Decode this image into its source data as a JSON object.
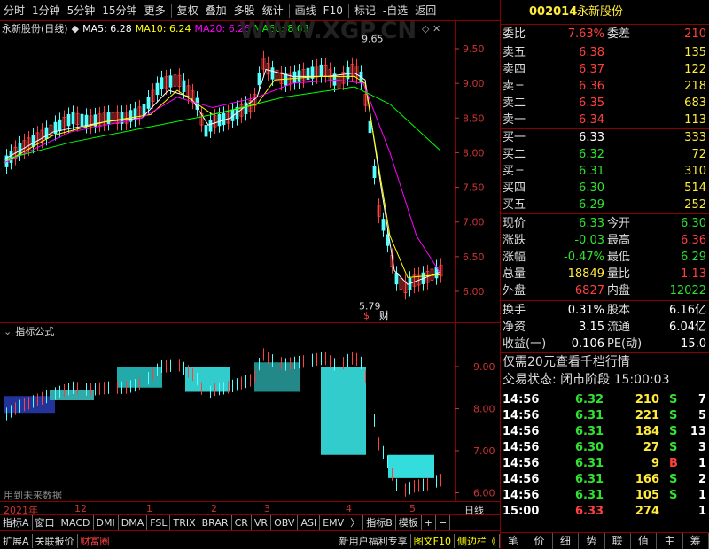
{
  "toolbar": {
    "items": [
      "分时",
      "1分钟",
      "5分钟",
      "15分钟",
      "更多",
      "复权",
      "叠加",
      "多股",
      "统计",
      "画线",
      "F10",
      "标记",
      "-自选",
      "返回"
    ]
  },
  "info": {
    "name": "永新股份(日线)",
    "ma5": "MA5: 6.28",
    "ma10": "MA10: 6.24",
    "ma20": "MA20: 6.26",
    "ma60": "MA60: 8.03"
  },
  "watermark": "WWW.XGP.CN",
  "annotations": {
    "high": "9.65",
    "low": "5.79",
    "flag1": "$",
    "flag2": "财"
  },
  "main_axis": {
    "ticks": [
      "9.50",
      "9.00",
      "8.50",
      "8.00",
      "7.50",
      "7.00",
      "6.50",
      "6.00"
    ]
  },
  "sub_axis": {
    "ticks": [
      "9.00",
      "8.00",
      "7.00",
      "6.00"
    ]
  },
  "sub": {
    "title": "指标公式",
    "hint": "用到未来数据"
  },
  "xaxis": {
    "labels": [
      "2021年",
      "12",
      "1",
      "2",
      "3",
      "4",
      "5"
    ],
    "mode": "日线"
  },
  "tabs": [
    "指标A",
    "窗口",
    "MACD",
    "DMI",
    "DMA",
    "FSL",
    "TRIX",
    "BRAR",
    "CR",
    "VR",
    "OBV",
    "ASI",
    "EMV",
    "〉",
    "指标B",
    "模板",
    "+",
    "−"
  ],
  "bottombar": [
    "扩展A",
    "关联报价",
    "财富圈",
    "新用户福利专享",
    "图文F10",
    "侧边栏《"
  ],
  "quote": {
    "code": "002014",
    "name": "永新股份",
    "weibi_label": "委比",
    "weibi": "7.63%",
    "weicha_label": "委差",
    "weicha": "210",
    "asks": [
      {
        "l": "卖五",
        "p": "6.38",
        "v": "135"
      },
      {
        "l": "卖四",
        "p": "6.37",
        "v": "122"
      },
      {
        "l": "卖三",
        "p": "6.36",
        "v": "218"
      },
      {
        "l": "卖二",
        "p": "6.35",
        "v": "683"
      },
      {
        "l": "卖一",
        "p": "6.34",
        "v": "113"
      }
    ],
    "bids": [
      {
        "l": "买一",
        "p": "6.33",
        "v": "333"
      },
      {
        "l": "买二",
        "p": "6.32",
        "v": "72"
      },
      {
        "l": "买三",
        "p": "6.31",
        "v": "310"
      },
      {
        "l": "买四",
        "p": "6.30",
        "v": "514"
      },
      {
        "l": "买五",
        "p": "6.29",
        "v": "252"
      }
    ],
    "stats": [
      {
        "l1": "现价",
        "v1": "6.33",
        "l2": "今开",
        "v2": "6.30"
      },
      {
        "l1": "涨跌",
        "v1": "-0.03",
        "l2": "最高",
        "v2": "6.36"
      },
      {
        "l1": "涨幅",
        "v1": "-0.47%",
        "l2": "最低",
        "v2": "6.29"
      },
      {
        "l1": "总量",
        "v1": "18849",
        "l2": "量比",
        "v2": "1.13"
      },
      {
        "l1": "外盘",
        "v1": "6827",
        "l2": "内盘",
        "v2": "12022"
      }
    ],
    "fund": [
      {
        "l1": "换手",
        "v1": "0.31%",
        "l2": "股本",
        "v2": "6.16亿"
      },
      {
        "l1": "净资",
        "v1": "3.15",
        "l2": "流通",
        "v2": "6.04亿"
      },
      {
        "l1": "收益(一)",
        "v1": "0.106",
        "l2": "PE(动)",
        "v2": "15.0"
      }
    ],
    "promo": "仅需20元查看千档行情",
    "status": "交易状态: 闭市阶段 15:00:03",
    "ticks": [
      {
        "t": "14:56",
        "p": "6.32",
        "v": "210",
        "s": "S",
        "n": "7"
      },
      {
        "t": "14:56",
        "p": "6.31",
        "v": "221",
        "s": "S",
        "n": "5"
      },
      {
        "t": "14:56",
        "p": "6.31",
        "v": "184",
        "s": "S",
        "n": "13"
      },
      {
        "t": "14:56",
        "p": "6.30",
        "v": "27",
        "s": "S",
        "n": "3"
      },
      {
        "t": "14:56",
        "p": "6.31",
        "v": "9",
        "s": "B",
        "n": "1"
      },
      {
        "t": "14:56",
        "p": "6.31",
        "v": "166",
        "s": "S",
        "n": "2"
      },
      {
        "t": "14:56",
        "p": "6.31",
        "v": "105",
        "s": "S",
        "n": "1"
      },
      {
        "t": "15:00",
        "p": "6.33",
        "v": "274",
        "s": "",
        "n": "1"
      }
    ],
    "rtabs": [
      "笔",
      "价",
      "细",
      "势",
      "联",
      "值",
      "主",
      "筹"
    ]
  }
}
